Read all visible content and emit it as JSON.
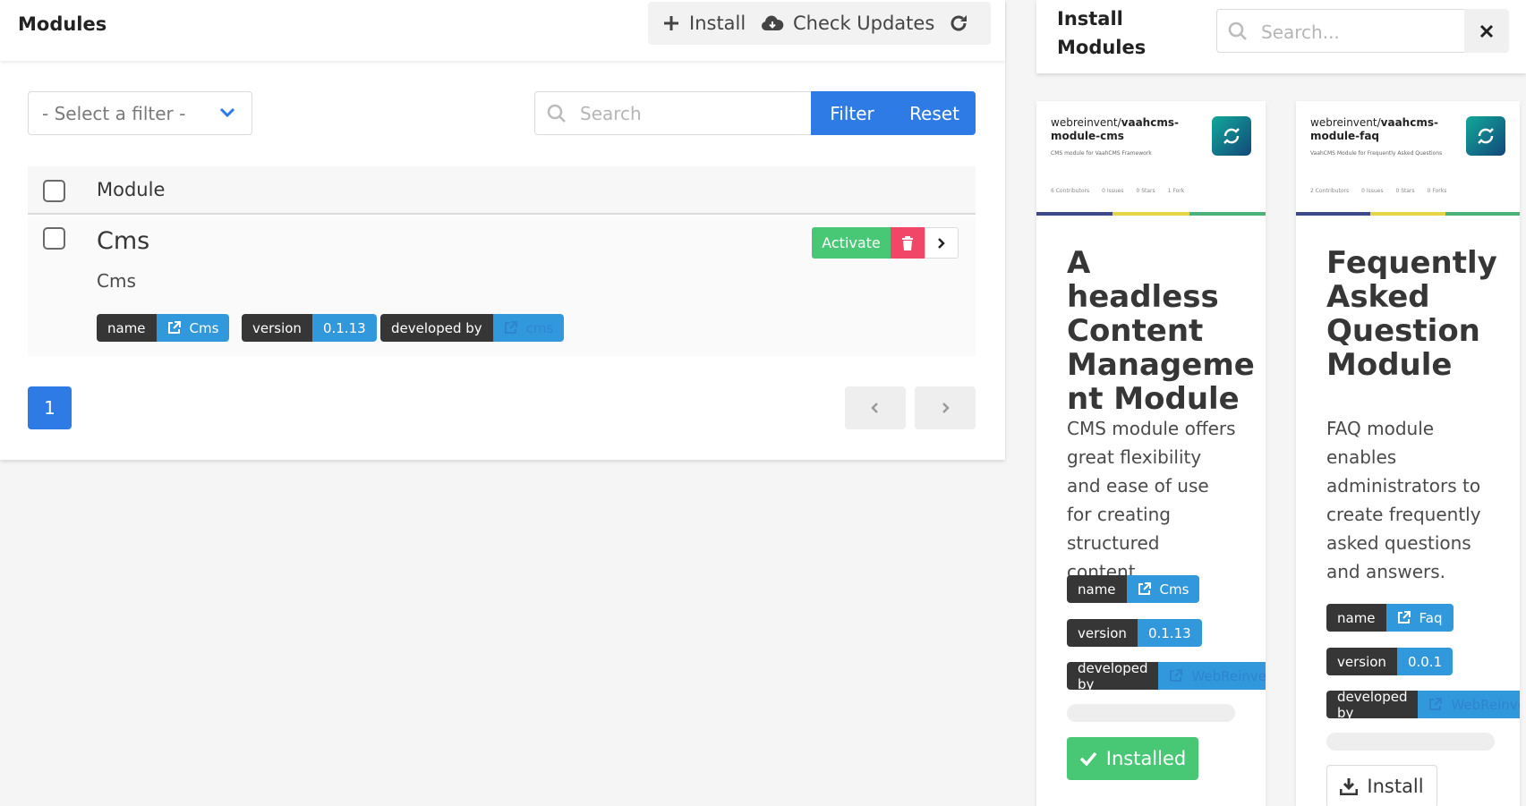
{
  "modules_panel": {
    "title": "Modules",
    "actions": {
      "install": "Install",
      "check_updates": "Check Updates"
    },
    "filter": {
      "placeholder": "- Select a filter -"
    },
    "search": {
      "placeholder": "Search",
      "filter_label": "Filter",
      "reset_label": "Reset"
    },
    "table": {
      "header": "Module",
      "rows": [
        {
          "name": "Cms",
          "slug": "Cms",
          "activate_label": "Activate",
          "tags": [
            {
              "key": "name",
              "value": "Cms"
            },
            {
              "key": "version",
              "value": "0.1.13"
            },
            {
              "key": "developed by",
              "value": "cms"
            }
          ]
        }
      ]
    },
    "pagination": {
      "current": "1"
    }
  },
  "install_panel": {
    "title": "Install Modules",
    "search_placeholder": "Search...",
    "cards": [
      {
        "repo_owner": "webreinvent/",
        "repo_name": "vaahcms-module-cms",
        "repo_sub": "CMS module for VaahCMS Framework",
        "stats": [
          "6 Contributors",
          "0 Issues",
          "0 Stars",
          "1 Fork"
        ],
        "title": "A headless Content Manageme nt Module",
        "description": "CMS module offers great flexibility and ease of use for creating structured content.",
        "tags": [
          {
            "key": "name",
            "value": "Cms"
          },
          {
            "key": "version",
            "value": "0.1.13"
          },
          {
            "key": "developed by",
            "value": "WebReinvent"
          }
        ],
        "status_label": "Installed"
      },
      {
        "repo_owner": "webreinvent/",
        "repo_name": "vaahcms-module-faq",
        "repo_sub": "VaahCMS Module for Frequently Asked Questions",
        "stats": [
          "2 Contributors",
          "0 Issues",
          "0 Stars",
          "0 Forks"
        ],
        "title": "Fequently Asked Question Module",
        "description": "FAQ module enables administrators to create frequently asked questions and answers.",
        "tags": [
          {
            "key": "name",
            "value": "Faq"
          },
          {
            "key": "version",
            "value": "0.0.1"
          },
          {
            "key": "developed by",
            "value": "WebReinvent"
          }
        ],
        "action_label": "Install"
      }
    ]
  },
  "colors": {
    "primary": "#2f7be5",
    "success": "#48c774",
    "danger": "#f14668",
    "info": "#3298dc",
    "dark": "#363636"
  }
}
